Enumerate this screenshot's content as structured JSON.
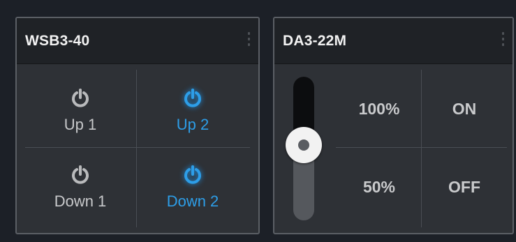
{
  "wsb_card": {
    "title": "WSB3-40",
    "buttons": [
      {
        "label": "Up 1",
        "active": false
      },
      {
        "label": "Up 2",
        "active": true
      },
      {
        "label": "Down 1",
        "active": false
      },
      {
        "label": "Down 2",
        "active": true
      }
    ]
  },
  "da_card": {
    "title": "DA3-22M",
    "dimmer_level_fraction": 0.5,
    "level_buttons": [
      "100%",
      "50%"
    ],
    "switch_buttons": [
      "ON",
      "OFF"
    ]
  },
  "colors": {
    "accent": "#2d9ee8",
    "inactive_icon": "#b9babc",
    "background": "#1c2027",
    "card": "#2e3136",
    "header": "#1f2226"
  },
  "icons": {
    "power": "power-icon",
    "menu": "kebab-menu-icon"
  }
}
